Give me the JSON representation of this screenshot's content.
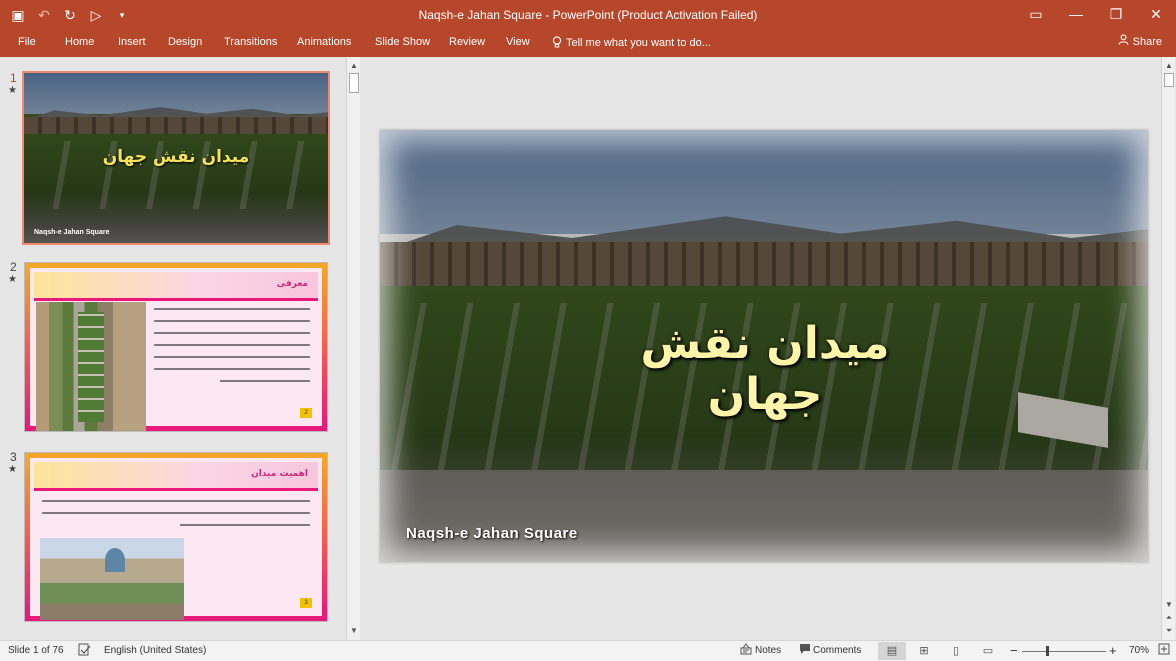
{
  "window": {
    "title": "Naqsh-e Jahan Square - PowerPoint (Product Activation Failed)",
    "qat_icons": [
      "save-icon",
      "undo-icon",
      "redo-icon",
      "start-from-beginning-icon",
      "customize-qat-icon"
    ],
    "controls": [
      "ribbon-display-icon",
      "minimize-icon",
      "maximize-icon",
      "close-icon"
    ]
  },
  "ribbon": {
    "tabs": [
      {
        "label": "File"
      },
      {
        "label": "Home"
      },
      {
        "label": "Insert"
      },
      {
        "label": "Design"
      },
      {
        "label": "Transitions"
      },
      {
        "label": "Animations"
      },
      {
        "label": "Slide Show"
      },
      {
        "label": "Review"
      },
      {
        "label": "View"
      }
    ],
    "tell_me": "Tell me what you want to do...",
    "share": "Share"
  },
  "slides": {
    "items": [
      {
        "number": "1",
        "star": "★",
        "title": "میدان نقش جهان",
        "subtitle": "Naqsh-e Jahan Square"
      },
      {
        "number": "2",
        "star": "★",
        "title": "معرفی",
        "page": "2"
      },
      {
        "number": "3",
        "star": "★",
        "title": "اهمیت میدان",
        "page": "3"
      }
    ]
  },
  "main_slide": {
    "title": "میدان نقش جهان",
    "subtitle": "Naqsh-e Jahan Square"
  },
  "status": {
    "slide_counter": "Slide 1 of 76",
    "language": "English (United States)",
    "notes": "Notes",
    "comments": "Comments",
    "zoom_minus": "−",
    "zoom_plus": "+",
    "zoom": "70%",
    "zoom_fraction": 0.7
  },
  "colors": {
    "accent": "#b7472a",
    "thumb_selected": "#f08a6c",
    "slide_title": "#fff4a8"
  }
}
